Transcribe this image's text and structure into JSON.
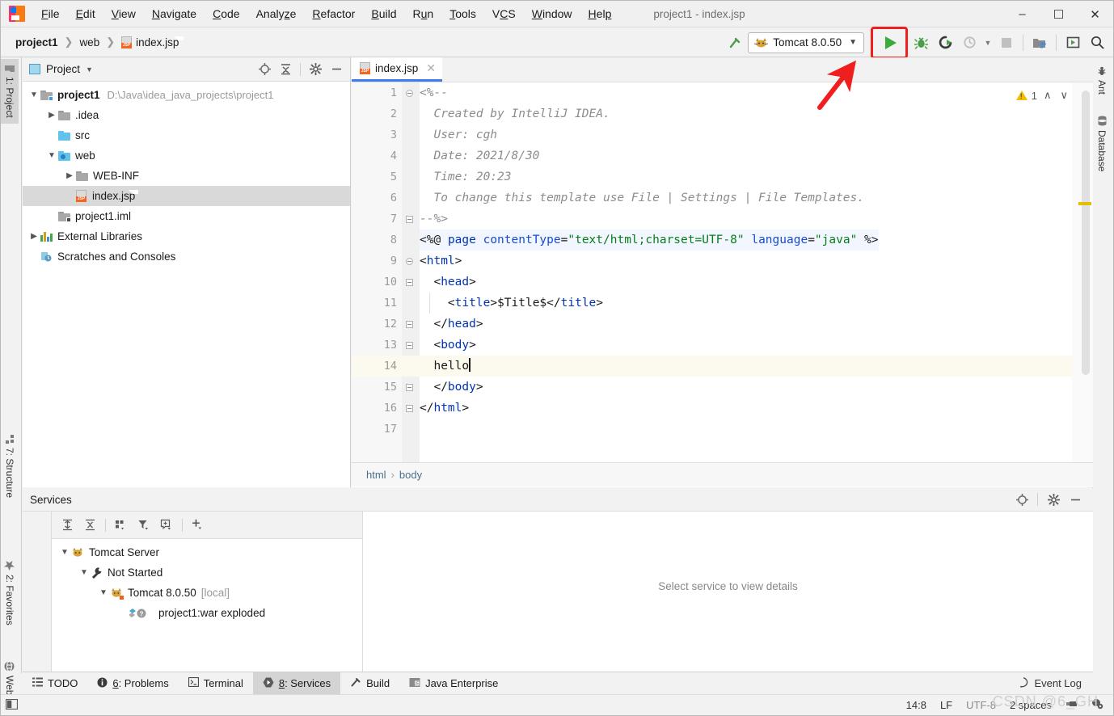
{
  "window": {
    "title": "project1 - index.jsp",
    "minimize": "–",
    "maximize": "☐",
    "close": "✕"
  },
  "menu": [
    {
      "label": "File"
    },
    {
      "label": "Edit"
    },
    {
      "label": "View"
    },
    {
      "label": "Navigate"
    },
    {
      "label": "Code"
    },
    {
      "label": "Analyze"
    },
    {
      "label": "Refactor"
    },
    {
      "label": "Build"
    },
    {
      "label": "Run"
    },
    {
      "label": "Tools"
    },
    {
      "label": "VCS"
    },
    {
      "label": "Window"
    },
    {
      "label": "Help"
    }
  ],
  "navbar": {
    "breadcrumbs": [
      "project1",
      "web",
      "index.jsp"
    ],
    "separator": "›",
    "run_config": "Tomcat 8.0.50",
    "dropdown_caret": "▾",
    "icons": [
      "build-hammer-icon",
      "run-icon",
      "debug-icon",
      "run-with-coverage-icon",
      "profile-icon",
      "stop-icon",
      "project-structure-icon",
      "update-icon",
      "search-everywhere-icon"
    ]
  },
  "left_rail": {
    "tabs": [
      {
        "label": "1: Project",
        "selected": true,
        "icon": "project-folder-icon"
      },
      {
        "label": "7: Structure",
        "selected": false,
        "icon": "structure-icon"
      },
      {
        "label": "2: Favorites",
        "selected": false,
        "icon": "star-icon"
      },
      {
        "label": "Web",
        "selected": false,
        "icon": "web-globe-icon"
      }
    ]
  },
  "right_rail": {
    "tabs": [
      {
        "label": "Ant",
        "icon": "ant-icon"
      },
      {
        "label": "Database",
        "icon": "database-icon"
      }
    ]
  },
  "project_panel": {
    "title": "Project",
    "caret": "▾",
    "header_icons": [
      "locate-icon",
      "collapse-all-icon",
      "gear-icon",
      "hide-icon"
    ],
    "tree": [
      {
        "depth": 0,
        "arrow": "down",
        "label": "project1",
        "bold": true,
        "path": "D:\\Java\\idea_java_projects\\project1",
        "icon": "module-folder-icon",
        "selected": false
      },
      {
        "depth": 1,
        "arrow": "right",
        "label": ".idea",
        "icon": "folder-icon",
        "selected": false
      },
      {
        "depth": 1,
        "arrow": "none",
        "label": "src",
        "icon": "source-folder-icon",
        "selected": false
      },
      {
        "depth": 1,
        "arrow": "down",
        "label": "web",
        "icon": "web-folder-icon",
        "selected": false
      },
      {
        "depth": 2,
        "arrow": "right",
        "label": "WEB-INF",
        "icon": "folder-icon",
        "selected": false
      },
      {
        "depth": 2,
        "arrow": "none",
        "label": "index.jsp",
        "icon": "jsp-file-icon",
        "selected": true
      },
      {
        "depth": 1,
        "arrow": "none",
        "label": "project1.iml",
        "icon": "iml-file-icon",
        "selected": false
      },
      {
        "depth": 0,
        "arrow": "right",
        "label": "External Libraries",
        "icon": "libraries-icon",
        "selected": false
      },
      {
        "depth": 0,
        "arrow": "none",
        "label": "Scratches and Consoles",
        "icon": "scratches-icon",
        "selected": false
      }
    ]
  },
  "editor": {
    "tab": {
      "label": "index.jsp",
      "icon": "jsp-file-icon",
      "close": "✕"
    },
    "inspection": {
      "warning_count": "1",
      "up": "∧",
      "down": "∨"
    },
    "breadcrumbs": [
      "html",
      "body"
    ],
    "breadcrumb_sep": "›",
    "caret_position": "14:8",
    "lines": [
      {
        "n": "1",
        "fold": "minus-circle",
        "segments": [
          {
            "t": "<%--",
            "c": "cm"
          }
        ]
      },
      {
        "n": "2",
        "fold": "",
        "segments": [
          {
            "t": "  Created by IntelliJ IDEA.",
            "c": "cm"
          }
        ]
      },
      {
        "n": "3",
        "fold": "",
        "segments": [
          {
            "t": "  User: cgh",
            "c": "cm"
          }
        ]
      },
      {
        "n": "4",
        "fold": "",
        "segments": [
          {
            "t": "  Date: 2021/8/30",
            "c": "cm"
          }
        ]
      },
      {
        "n": "5",
        "fold": "",
        "segments": [
          {
            "t": "  Time: 20:23",
            "c": "cm"
          }
        ]
      },
      {
        "n": "6",
        "fold": "",
        "segments": [
          {
            "t": "  To change this template use File | Settings | File Templates.",
            "c": "cm"
          }
        ]
      },
      {
        "n": "7",
        "fold": "minus-square",
        "segments": [
          {
            "t": "--%>",
            "c": "cm"
          }
        ]
      },
      {
        "n": "8",
        "fold": "",
        "highlight_bg": true,
        "segments": [
          {
            "t": "<%@",
            "c": "plain"
          },
          {
            "t": " ",
            "c": "plain"
          },
          {
            "t": "page",
            "c": "tagb"
          },
          {
            "t": " ",
            "c": "plain"
          },
          {
            "t": "contentType",
            "c": "attr"
          },
          {
            "t": "=",
            "c": "plain"
          },
          {
            "t": "\"text/html;charset=UTF-8\"",
            "c": "str"
          },
          {
            "t": " ",
            "c": "plain"
          },
          {
            "t": "language",
            "c": "attr"
          },
          {
            "t": "=",
            "c": "plain"
          },
          {
            "t": "\"java\"",
            "c": "str"
          },
          {
            "t": " %>",
            "c": "plain"
          }
        ]
      },
      {
        "n": "9",
        "fold": "minus-circle",
        "segments": [
          {
            "t": "<",
            "c": "plain"
          },
          {
            "t": "html",
            "c": "tagb"
          },
          {
            "t": ">",
            "c": "plain"
          }
        ]
      },
      {
        "n": "10",
        "fold": "minus-square",
        "segments": [
          {
            "t": "  <",
            "c": "plain"
          },
          {
            "t": "head",
            "c": "tagb"
          },
          {
            "t": ">",
            "c": "plain"
          }
        ]
      },
      {
        "n": "11",
        "fold": "",
        "indent_guide": true,
        "segments": [
          {
            "t": "    <",
            "c": "plain"
          },
          {
            "t": "title",
            "c": "tagb"
          },
          {
            "t": ">$Title$</",
            "c": "plain"
          },
          {
            "t": "title",
            "c": "tagb"
          },
          {
            "t": ">",
            "c": "plain"
          }
        ]
      },
      {
        "n": "12",
        "fold": "minus-square",
        "segments": [
          {
            "t": "  </",
            "c": "plain"
          },
          {
            "t": "head",
            "c": "tagb"
          },
          {
            "t": ">",
            "c": "plain"
          }
        ]
      },
      {
        "n": "13",
        "fold": "minus-square",
        "segments": [
          {
            "t": "  <",
            "c": "plain"
          },
          {
            "t": "body",
            "c": "tagb"
          },
          {
            "t": ">",
            "c": "plain"
          }
        ]
      },
      {
        "n": "14",
        "fold": "",
        "current": true,
        "segments": [
          {
            "t": "  hello",
            "c": "plain"
          }
        ],
        "has_caret": true
      },
      {
        "n": "15",
        "fold": "minus-square",
        "segments": [
          {
            "t": "  </",
            "c": "plain"
          },
          {
            "t": "body",
            "c": "tagb"
          },
          {
            "t": ">",
            "c": "plain"
          }
        ]
      },
      {
        "n": "16",
        "fold": "minus-square",
        "segments": [
          {
            "t": "</",
            "c": "plain"
          },
          {
            "t": "html",
            "c": "tagb"
          },
          {
            "t": ">",
            "c": "plain"
          }
        ]
      },
      {
        "n": "17",
        "fold": "",
        "segments": [
          {
            "t": "",
            "c": "plain"
          }
        ]
      }
    ]
  },
  "services": {
    "title": "Services",
    "header_icons": [
      "locate-icon",
      "gear-icon",
      "hide-icon"
    ],
    "toolbar_icons": [
      "expand-all-icon",
      "collapse-all-icon",
      "group-by-icon",
      "filter-icon",
      "add-tab-icon",
      "add-icon"
    ],
    "tree": [
      {
        "depth": 0,
        "arrow": "down",
        "label": "Tomcat Server",
        "icon": "tomcat-icon",
        "suffix": ""
      },
      {
        "depth": 1,
        "arrow": "down",
        "label": "Not Started",
        "icon": "wrench-icon",
        "suffix": ""
      },
      {
        "depth": 2,
        "arrow": "down",
        "label": "Tomcat 8.0.50",
        "icon": "tomcat-icon",
        "suffix": "[local]"
      },
      {
        "depth": 3,
        "arrow": "none",
        "label": "project1:war exploded",
        "icon": "artifact-icon",
        "suffix": ""
      }
    ],
    "detail_placeholder": "Select service to view details"
  },
  "bottom_tabs": [
    {
      "label": "TODO",
      "icon": "todo-icon",
      "selected": false
    },
    {
      "label": "6: Problems",
      "icon": "problems-icon",
      "selected": false
    },
    {
      "label": "Terminal",
      "icon": "terminal-icon",
      "selected": false
    },
    {
      "label": "8: Services",
      "icon": "services-icon",
      "selected": true
    },
    {
      "label": "Build",
      "icon": "build-hammer-icon",
      "selected": false
    },
    {
      "label": "Java Enterprise",
      "icon": "java-enterprise-icon",
      "selected": false
    }
  ],
  "event_log": {
    "label": "Event Log",
    "icon": "balloon-icon"
  },
  "status_bar": {
    "caret": "14:8",
    "line_separator": "LF",
    "encoding": "UTF-8",
    "indent": "2 spaces",
    "icons": [
      "plug-icon",
      "settings-gear-icon"
    ]
  },
  "annotation": {
    "highlight_target": "run-button",
    "color": "#f01f1f",
    "shape": "arrow-pointing-to-run-button"
  },
  "watermark": "CSDN @6_GH",
  "colors": {
    "accent_blue": "#3d7eef",
    "run_green": "#3cab3c",
    "annotation_red": "#f01f1f",
    "warning_yellow": "#e2c000",
    "selection_gray": "#d9d9d9"
  }
}
